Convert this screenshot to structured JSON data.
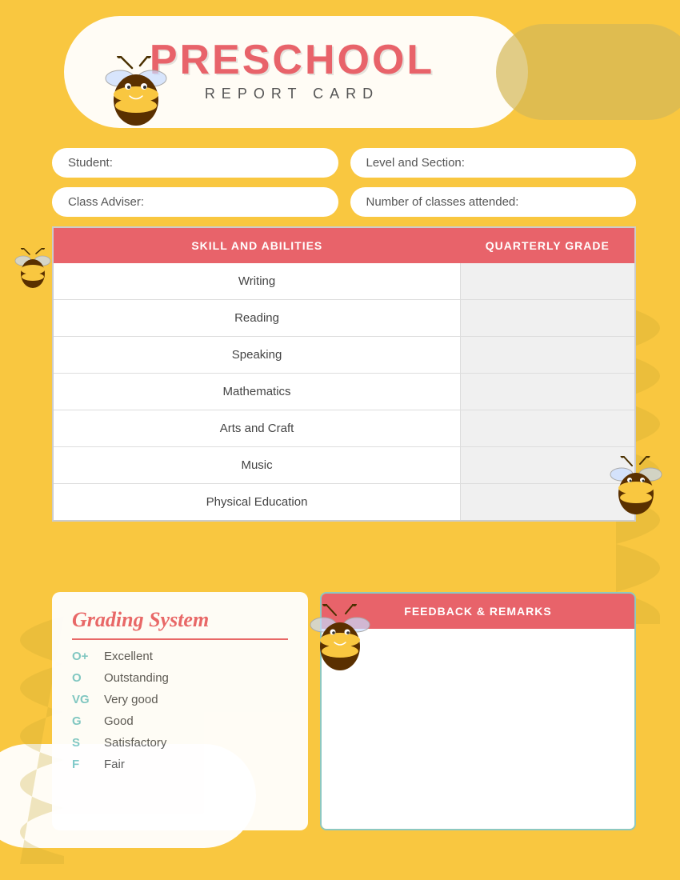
{
  "header": {
    "title": "PRESCHOOL",
    "subtitle": "REPORT CARD"
  },
  "info_fields": {
    "student_label": "Student:",
    "level_label": "Level and Section:",
    "adviser_label": "Class Adviser:",
    "classes_label": "Number of classes attended:"
  },
  "table": {
    "col1": "SKILL AND ABILITIES",
    "col2": "QUARTERLY GRADE",
    "rows": [
      "Writing",
      "Reading",
      "Speaking",
      "Mathematics",
      "Arts and Craft",
      "Music",
      "Physical Education"
    ]
  },
  "grading": {
    "title": "Grading System",
    "items": [
      {
        "code": "O+",
        "label": "Excellent"
      },
      {
        "code": "O",
        "label": "Outstanding"
      },
      {
        "code": "VG",
        "label": "Very good"
      },
      {
        "code": "G",
        "label": "Good"
      },
      {
        "code": "S",
        "label": "Satisfactory"
      },
      {
        "code": "F",
        "label": "Fair"
      }
    ]
  },
  "feedback": {
    "header": "FEEDBACK & REMARKS"
  }
}
